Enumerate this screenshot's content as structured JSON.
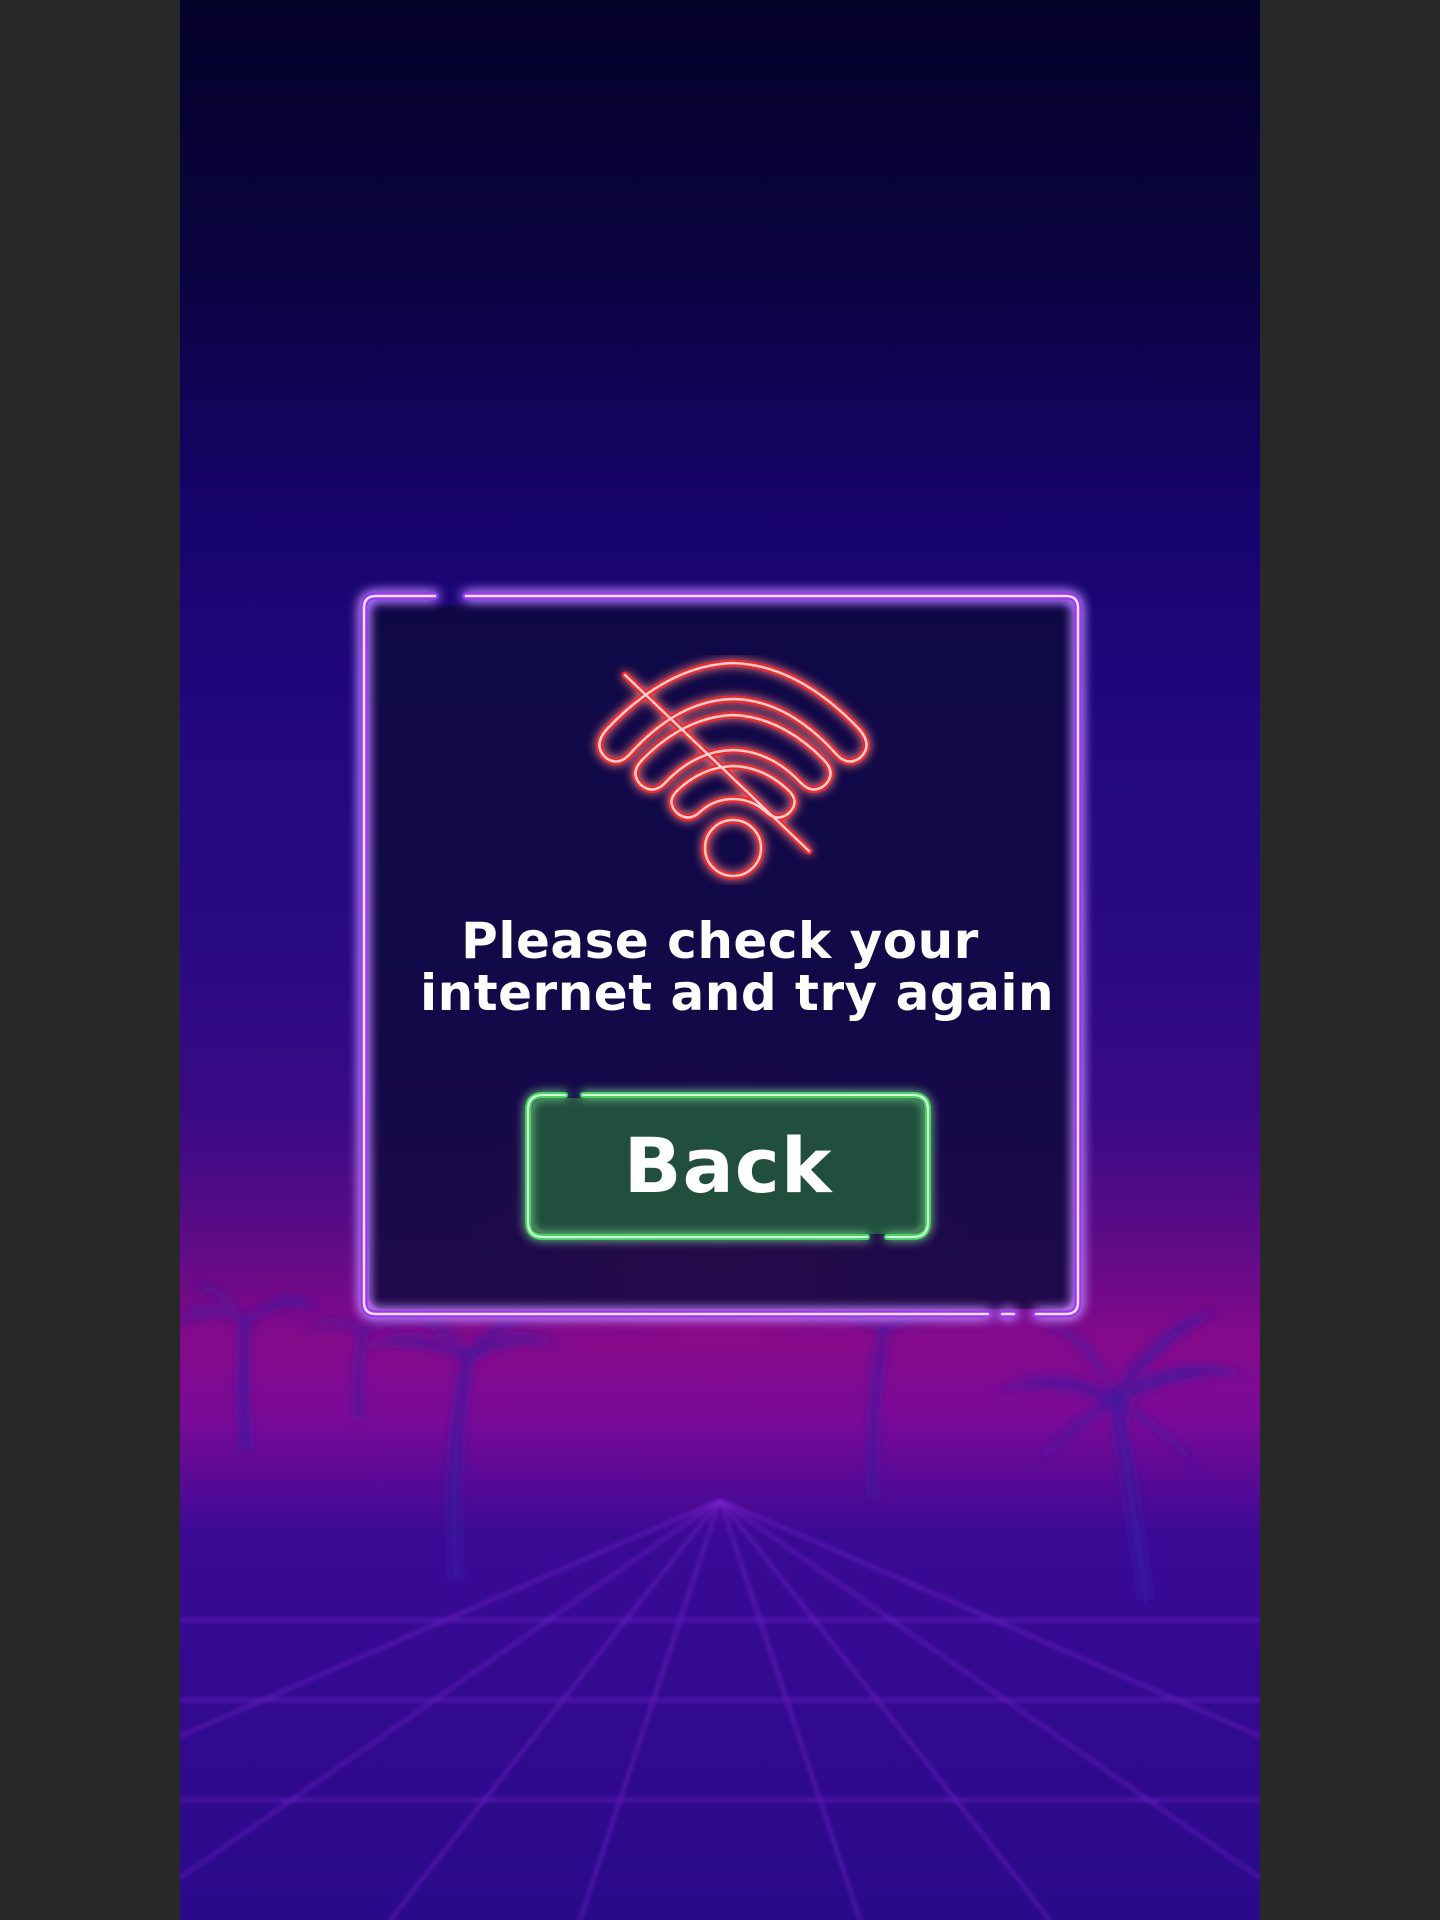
{
  "dialog": {
    "message_line1": "Please check your",
    "message_line2": "internet and try again",
    "back_button_label": "Back",
    "icon": "wifi-off-icon"
  },
  "colors": {
    "frame_neon": "#a033ff",
    "icon_neon": "#ff2a2a",
    "button_neon": "#39e05a",
    "button_fill": "#214f3e",
    "text": "#ffffff"
  }
}
